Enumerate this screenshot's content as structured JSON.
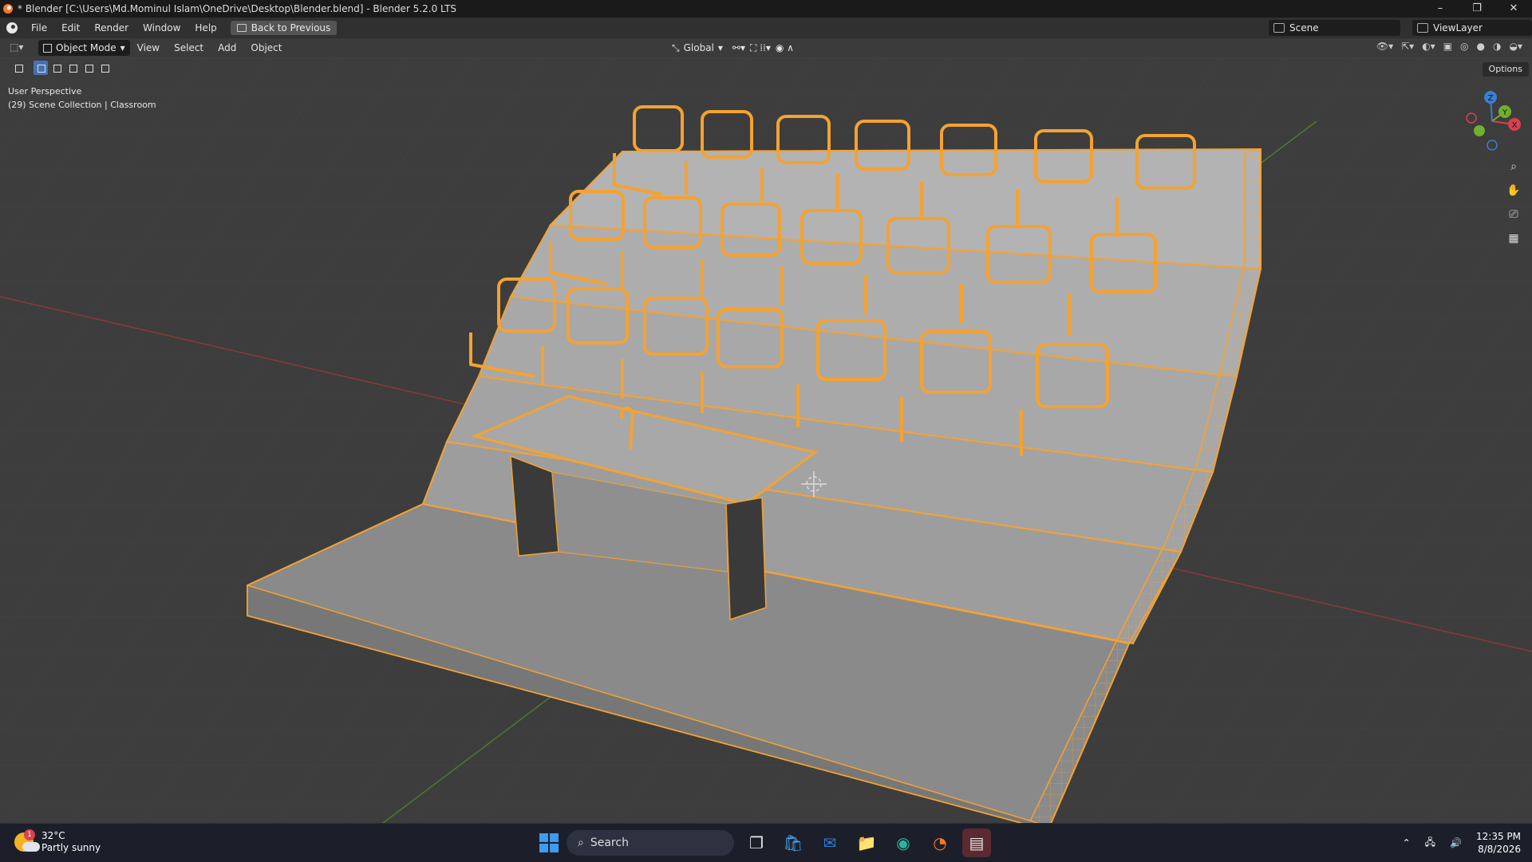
{
  "window": {
    "title": "* Blender [C:\\Users\\Md.Mominul Islam\\OneDrive\\Desktop\\Blender.blend] - Blender 5.2.0 LTS",
    "controls": [
      "–",
      "❐",
      "✕"
    ]
  },
  "topbar": {
    "menus": [
      "File",
      "Edit",
      "Render",
      "Window",
      "Help"
    ],
    "back_button": "Back to Previous",
    "scene": "Scene",
    "view_layer": "ViewLayer"
  },
  "viewport_header": {
    "mode": "Object Mode",
    "menus": [
      "View",
      "Select",
      "Add",
      "Object"
    ],
    "orientation": "Global",
    "options": "Options"
  },
  "viewport": {
    "perspective_label": "User Perspective",
    "collection_label": "(29) Scene Collection | Classroom",
    "selection_color": "#f5a231",
    "floor_color": "#3d3d3d",
    "gizmo_axes": [
      "Z",
      "Y",
      "X"
    ]
  },
  "taskbar": {
    "temperature": "32°C",
    "weather": "Partly sunny",
    "weather_badge": "1",
    "search_placeholder": "Search",
    "time": "12:35 PM",
    "date": "8/8/2026"
  }
}
